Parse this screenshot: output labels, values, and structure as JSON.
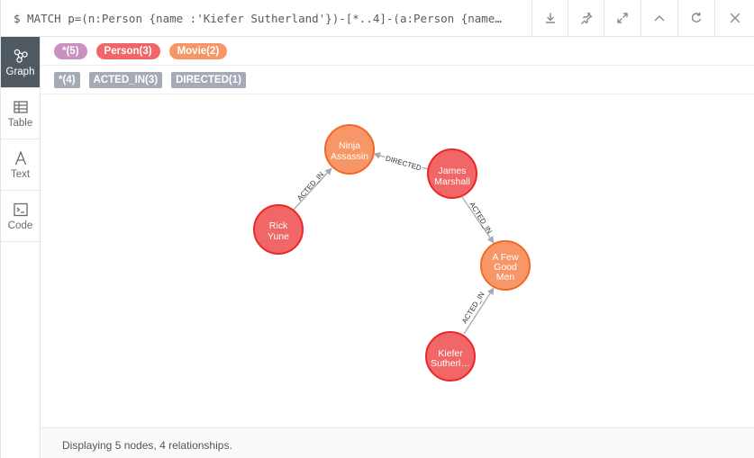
{
  "query": "$ MATCH p=(n:Person {name :'Kiefer Sutherland'})-[*..4]-(a:Person {name…",
  "toolbar": {
    "icons": [
      "download-icon",
      "pin-icon",
      "expand-icon",
      "collapse-icon",
      "refresh-icon",
      "close-icon"
    ]
  },
  "sidebar": {
    "items": [
      {
        "label": "Graph",
        "icon": "graph-icon",
        "active": true
      },
      {
        "label": "Table",
        "icon": "table-icon"
      },
      {
        "label": "Text",
        "icon": "text-icon"
      },
      {
        "label": "Code",
        "icon": "code-icon"
      }
    ]
  },
  "legend": {
    "labels": [
      {
        "text": "*(5)",
        "color": "#c990c0"
      },
      {
        "text": "Person(3)",
        "color": "#f16667"
      },
      {
        "text": "Movie(2)",
        "color": "#f79767"
      }
    ],
    "relationships": [
      {
        "text": "*(4)"
      },
      {
        "text": "ACTED_IN(3)"
      },
      {
        "text": "DIRECTED(1)"
      }
    ]
  },
  "graph": {
    "colors": {
      "person": "#f16667",
      "person_stroke": "#eb2728",
      "movie": "#f79767",
      "movie_stroke": "#f36924",
      "edge": "#a5abb6"
    },
    "nodes": [
      {
        "id": "ninja",
        "type": "movie",
        "lines": [
          "Ninja",
          "Assassin"
        ]
      },
      {
        "id": "james",
        "type": "person",
        "lines": [
          "James",
          "Marshall"
        ]
      },
      {
        "id": "rick",
        "type": "person",
        "lines": [
          "Rick",
          "Yune"
        ]
      },
      {
        "id": "fewgood",
        "type": "movie",
        "lines": [
          "A Few",
          "Good",
          "Men"
        ]
      },
      {
        "id": "kiefer",
        "type": "person",
        "lines": [
          "Kiefer",
          "Sutherl…"
        ]
      }
    ],
    "relationships": [
      {
        "label": "ACTED_IN",
        "from": "rick",
        "to": "ninja"
      },
      {
        "label": "DIRECTED",
        "from": "james",
        "to": "ninja"
      },
      {
        "label": "ACTED_IN",
        "from": "james",
        "to": "fewgood"
      },
      {
        "label": "ACTED_IN",
        "from": "kiefer",
        "to": "fewgood"
      }
    ]
  },
  "status": "Displaying 5 nodes, 4 relationships."
}
